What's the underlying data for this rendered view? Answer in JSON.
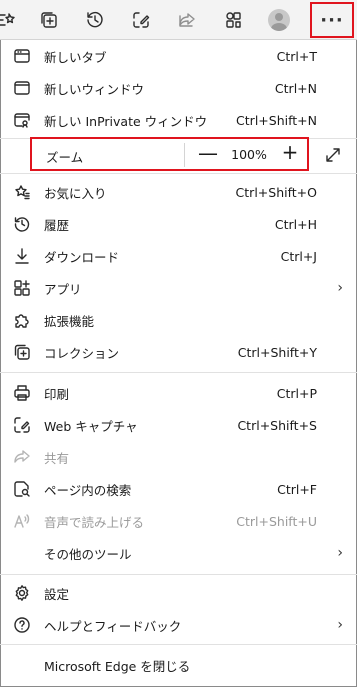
{
  "toolbar": {
    "icons": [
      "reading-list-icon",
      "collections-icon",
      "history-icon",
      "screenshot-icon",
      "share-icon",
      "extensions-icon"
    ],
    "more_label": "···"
  },
  "menu": {
    "new_tab": {
      "label": "新しいタブ",
      "shortcut": "Ctrl+T"
    },
    "new_window": {
      "label": "新しいウィンドウ",
      "shortcut": "Ctrl+N"
    },
    "new_inprivate": {
      "label": "新しい InPrivate ウィンドウ",
      "shortcut": "Ctrl+Shift+N"
    },
    "zoom": {
      "label": "ズーム",
      "minus": "—",
      "value": "100%",
      "plus": "+"
    },
    "favorites": {
      "label": "お気に入り",
      "shortcut": "Ctrl+Shift+O"
    },
    "history": {
      "label": "履歴",
      "shortcut": "Ctrl+H"
    },
    "downloads": {
      "label": "ダウンロード",
      "shortcut": "Ctrl+J"
    },
    "apps": {
      "label": "アプリ",
      "chevron": "›"
    },
    "extensions": {
      "label": "拡張機能"
    },
    "collections": {
      "label": "コレクション",
      "shortcut": "Ctrl+Shift+Y"
    },
    "print": {
      "label": "印刷",
      "shortcut": "Ctrl+P"
    },
    "web_capture": {
      "label": "Web キャプチャ",
      "shortcut": "Ctrl+Shift+S"
    },
    "share": {
      "label": "共有"
    },
    "find": {
      "label": "ページ内の検索",
      "shortcut": "Ctrl+F"
    },
    "read_aloud": {
      "label": "音声で読み上げる",
      "shortcut": "Ctrl+Shift+U"
    },
    "more_tools": {
      "label": "その他のツール",
      "chevron": "›"
    },
    "settings": {
      "label": "設定"
    },
    "help": {
      "label": "ヘルプとフィードバック",
      "chevron": "›"
    },
    "close": {
      "label": "Microsoft Edge を閉じる"
    }
  },
  "colors": {
    "highlight": "#e0141e",
    "disabled": "#9a9a9a"
  }
}
